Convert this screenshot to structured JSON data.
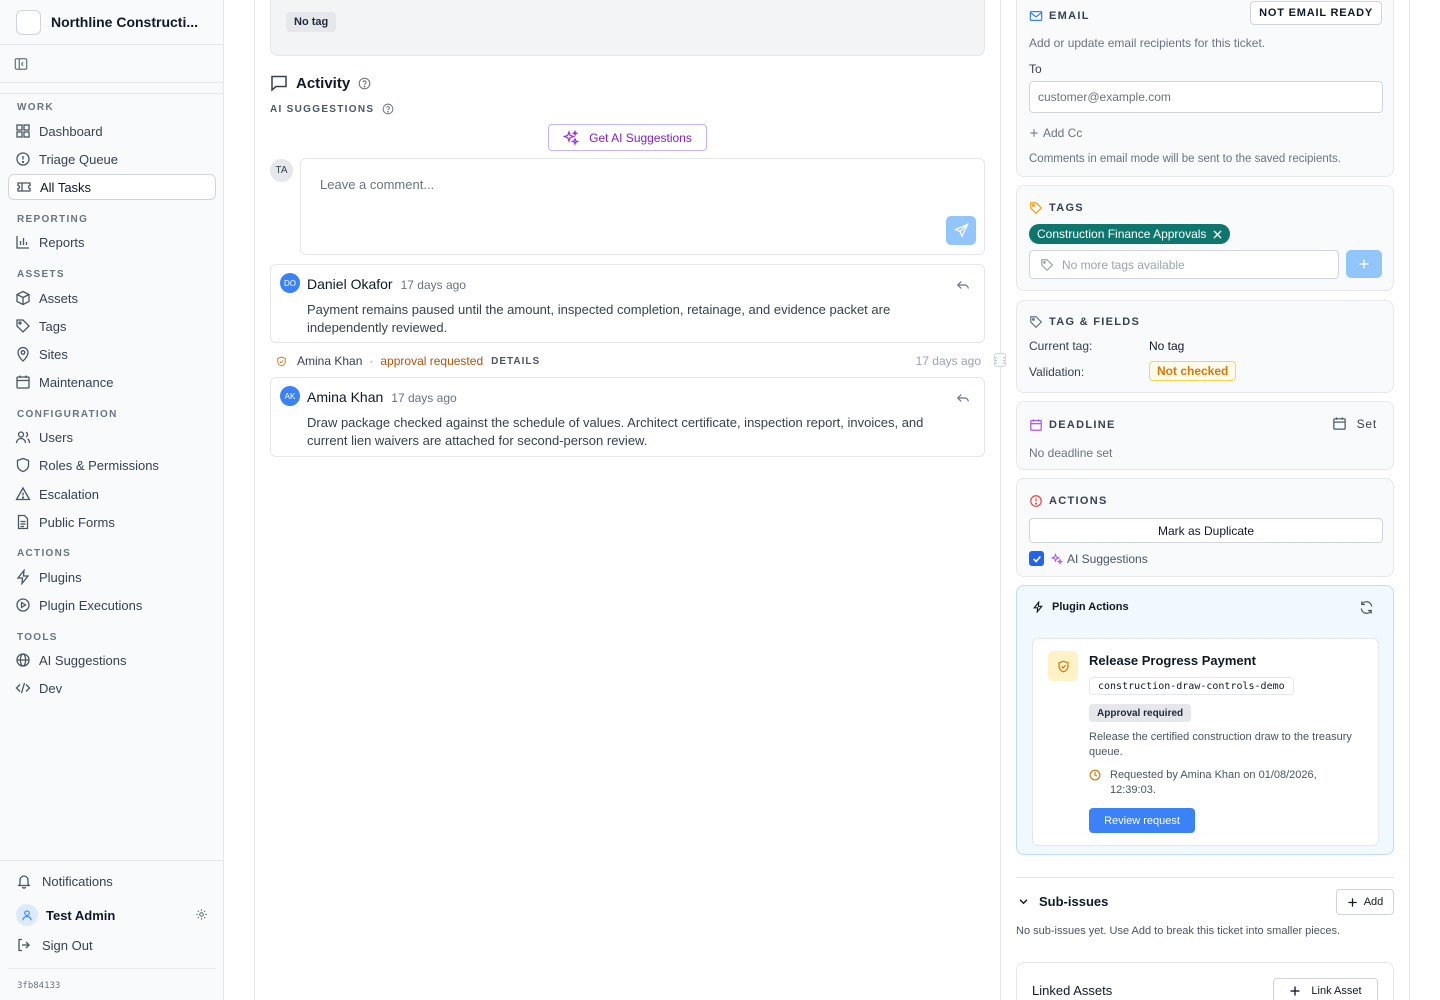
{
  "sidebar": {
    "org_name": "Northline Constructi...",
    "sections": {
      "work": "WORK",
      "reporting": "REPORTING",
      "assets": "ASSETS",
      "configuration": "CONFIGURATION",
      "actions": "ACTIONS",
      "tools": "TOOLS"
    },
    "items": {
      "dashboard": "Dashboard",
      "triage": "Triage Queue",
      "all_tasks": "All Tasks",
      "reports": "Reports",
      "assets": "Assets",
      "tags": "Tags",
      "sites": "Sites",
      "maintenance": "Maintenance",
      "users": "Users",
      "roles": "Roles & Permissions",
      "escalation": "Escalation",
      "public_forms": "Public Forms",
      "plugins": "Plugins",
      "plugin_executions": "Plugin Executions",
      "ai_suggestions": "AI Suggestions",
      "dev": "Dev"
    },
    "notifications": "Notifications",
    "user_name": "Test Admin",
    "sign_out": "Sign Out",
    "version": "3fb84133"
  },
  "main": {
    "top_tag": "No tag",
    "activity_title": "Activity",
    "ai_label": "AI SUGGESTIONS",
    "get_ai_button": "Get AI Suggestions",
    "current_user_initials": "TA",
    "comment_placeholder": "Leave a comment...",
    "comments": [
      {
        "initials": "DO",
        "author": "Daniel Okafor",
        "time": "17 days ago",
        "body": "Payment remains paused until the amount, inspected completion, retainage, and evidence packet are independently reviewed."
      },
      {
        "initials": "AK",
        "author": "Amina Khan",
        "time": "17 days ago",
        "body": "Draw package checked against the schedule of values. Architect certificate, inspection report, invoices, and current lien waivers are attached for second-person review."
      }
    ],
    "event": {
      "actor": "Amina Khan",
      "separator": "·",
      "action": "approval requested",
      "details": "DETAILS",
      "time": "17 days ago"
    }
  },
  "right": {
    "email": {
      "label": "EMAIL",
      "status": "NOT EMAIL READY",
      "help": "Add or update email recipients for this ticket.",
      "to_label": "To",
      "to_placeholder": "customer@example.com",
      "add_cc": "Add Cc",
      "note": "Comments in email mode will be sent to the saved recipients."
    },
    "tags": {
      "label": "TAGS",
      "chip": "Construction Finance Approvals",
      "input_placeholder": "No more tags available"
    },
    "tag_fields": {
      "label": "TAG & FIELDS",
      "current_tag_key": "Current tag:",
      "current_tag_val": "No tag",
      "validation_key": "Validation:",
      "validation_val": "Not checked"
    },
    "deadline": {
      "label": "DEADLINE",
      "set": "Set",
      "value": "No deadline set"
    },
    "actions": {
      "label": "ACTIONS",
      "duplicate": "Mark as Duplicate",
      "ai_checkbox": "AI Suggestions"
    },
    "plugin": {
      "title": "Plugin Actions",
      "action_title": "Release Progress Payment",
      "code": "construction-draw-controls-demo",
      "status": "Approval required",
      "description": "Release the certified construction draw to the treasury queue.",
      "requested": "Requested by Amina Khan on 01/08/2026, 12:39:03.",
      "review": "Review request"
    },
    "sub_issues": {
      "title": "Sub-issues",
      "add": "Add",
      "empty": "No sub-issues yet. Use Add to break this ticket into smaller pieces."
    },
    "linked": {
      "title": "Linked Assets",
      "link_button": "Link Asset"
    }
  }
}
